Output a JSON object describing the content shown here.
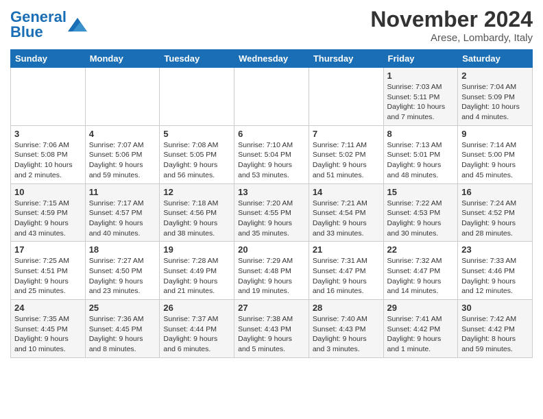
{
  "header": {
    "logo_general": "General",
    "logo_blue": "Blue",
    "month_title": "November 2024",
    "location": "Arese, Lombardy, Italy"
  },
  "days_of_week": [
    "Sunday",
    "Monday",
    "Tuesday",
    "Wednesday",
    "Thursday",
    "Friday",
    "Saturday"
  ],
  "weeks": [
    [
      {
        "day": "",
        "info": ""
      },
      {
        "day": "",
        "info": ""
      },
      {
        "day": "",
        "info": ""
      },
      {
        "day": "",
        "info": ""
      },
      {
        "day": "",
        "info": ""
      },
      {
        "day": "1",
        "info": "Sunrise: 7:03 AM\nSunset: 5:11 PM\nDaylight: 10 hours and 7 minutes."
      },
      {
        "day": "2",
        "info": "Sunrise: 7:04 AM\nSunset: 5:09 PM\nDaylight: 10 hours and 4 minutes."
      }
    ],
    [
      {
        "day": "3",
        "info": "Sunrise: 7:06 AM\nSunset: 5:08 PM\nDaylight: 10 hours and 2 minutes."
      },
      {
        "day": "4",
        "info": "Sunrise: 7:07 AM\nSunset: 5:06 PM\nDaylight: 9 hours and 59 minutes."
      },
      {
        "day": "5",
        "info": "Sunrise: 7:08 AM\nSunset: 5:05 PM\nDaylight: 9 hours and 56 minutes."
      },
      {
        "day": "6",
        "info": "Sunrise: 7:10 AM\nSunset: 5:04 PM\nDaylight: 9 hours and 53 minutes."
      },
      {
        "day": "7",
        "info": "Sunrise: 7:11 AM\nSunset: 5:02 PM\nDaylight: 9 hours and 51 minutes."
      },
      {
        "day": "8",
        "info": "Sunrise: 7:13 AM\nSunset: 5:01 PM\nDaylight: 9 hours and 48 minutes."
      },
      {
        "day": "9",
        "info": "Sunrise: 7:14 AM\nSunset: 5:00 PM\nDaylight: 9 hours and 45 minutes."
      }
    ],
    [
      {
        "day": "10",
        "info": "Sunrise: 7:15 AM\nSunset: 4:59 PM\nDaylight: 9 hours and 43 minutes."
      },
      {
        "day": "11",
        "info": "Sunrise: 7:17 AM\nSunset: 4:57 PM\nDaylight: 9 hours and 40 minutes."
      },
      {
        "day": "12",
        "info": "Sunrise: 7:18 AM\nSunset: 4:56 PM\nDaylight: 9 hours and 38 minutes."
      },
      {
        "day": "13",
        "info": "Sunrise: 7:20 AM\nSunset: 4:55 PM\nDaylight: 9 hours and 35 minutes."
      },
      {
        "day": "14",
        "info": "Sunrise: 7:21 AM\nSunset: 4:54 PM\nDaylight: 9 hours and 33 minutes."
      },
      {
        "day": "15",
        "info": "Sunrise: 7:22 AM\nSunset: 4:53 PM\nDaylight: 9 hours and 30 minutes."
      },
      {
        "day": "16",
        "info": "Sunrise: 7:24 AM\nSunset: 4:52 PM\nDaylight: 9 hours and 28 minutes."
      }
    ],
    [
      {
        "day": "17",
        "info": "Sunrise: 7:25 AM\nSunset: 4:51 PM\nDaylight: 9 hours and 25 minutes."
      },
      {
        "day": "18",
        "info": "Sunrise: 7:27 AM\nSunset: 4:50 PM\nDaylight: 9 hours and 23 minutes."
      },
      {
        "day": "19",
        "info": "Sunrise: 7:28 AM\nSunset: 4:49 PM\nDaylight: 9 hours and 21 minutes."
      },
      {
        "day": "20",
        "info": "Sunrise: 7:29 AM\nSunset: 4:48 PM\nDaylight: 9 hours and 19 minutes."
      },
      {
        "day": "21",
        "info": "Sunrise: 7:31 AM\nSunset: 4:47 PM\nDaylight: 9 hours and 16 minutes."
      },
      {
        "day": "22",
        "info": "Sunrise: 7:32 AM\nSunset: 4:47 PM\nDaylight: 9 hours and 14 minutes."
      },
      {
        "day": "23",
        "info": "Sunrise: 7:33 AM\nSunset: 4:46 PM\nDaylight: 9 hours and 12 minutes."
      }
    ],
    [
      {
        "day": "24",
        "info": "Sunrise: 7:35 AM\nSunset: 4:45 PM\nDaylight: 9 hours and 10 minutes."
      },
      {
        "day": "25",
        "info": "Sunrise: 7:36 AM\nSunset: 4:45 PM\nDaylight: 9 hours and 8 minutes."
      },
      {
        "day": "26",
        "info": "Sunrise: 7:37 AM\nSunset: 4:44 PM\nDaylight: 9 hours and 6 minutes."
      },
      {
        "day": "27",
        "info": "Sunrise: 7:38 AM\nSunset: 4:43 PM\nDaylight: 9 hours and 5 minutes."
      },
      {
        "day": "28",
        "info": "Sunrise: 7:40 AM\nSunset: 4:43 PM\nDaylight: 9 hours and 3 minutes."
      },
      {
        "day": "29",
        "info": "Sunrise: 7:41 AM\nSunset: 4:42 PM\nDaylight: 9 hours and 1 minute."
      },
      {
        "day": "30",
        "info": "Sunrise: 7:42 AM\nSunset: 4:42 PM\nDaylight: 8 hours and 59 minutes."
      }
    ]
  ]
}
